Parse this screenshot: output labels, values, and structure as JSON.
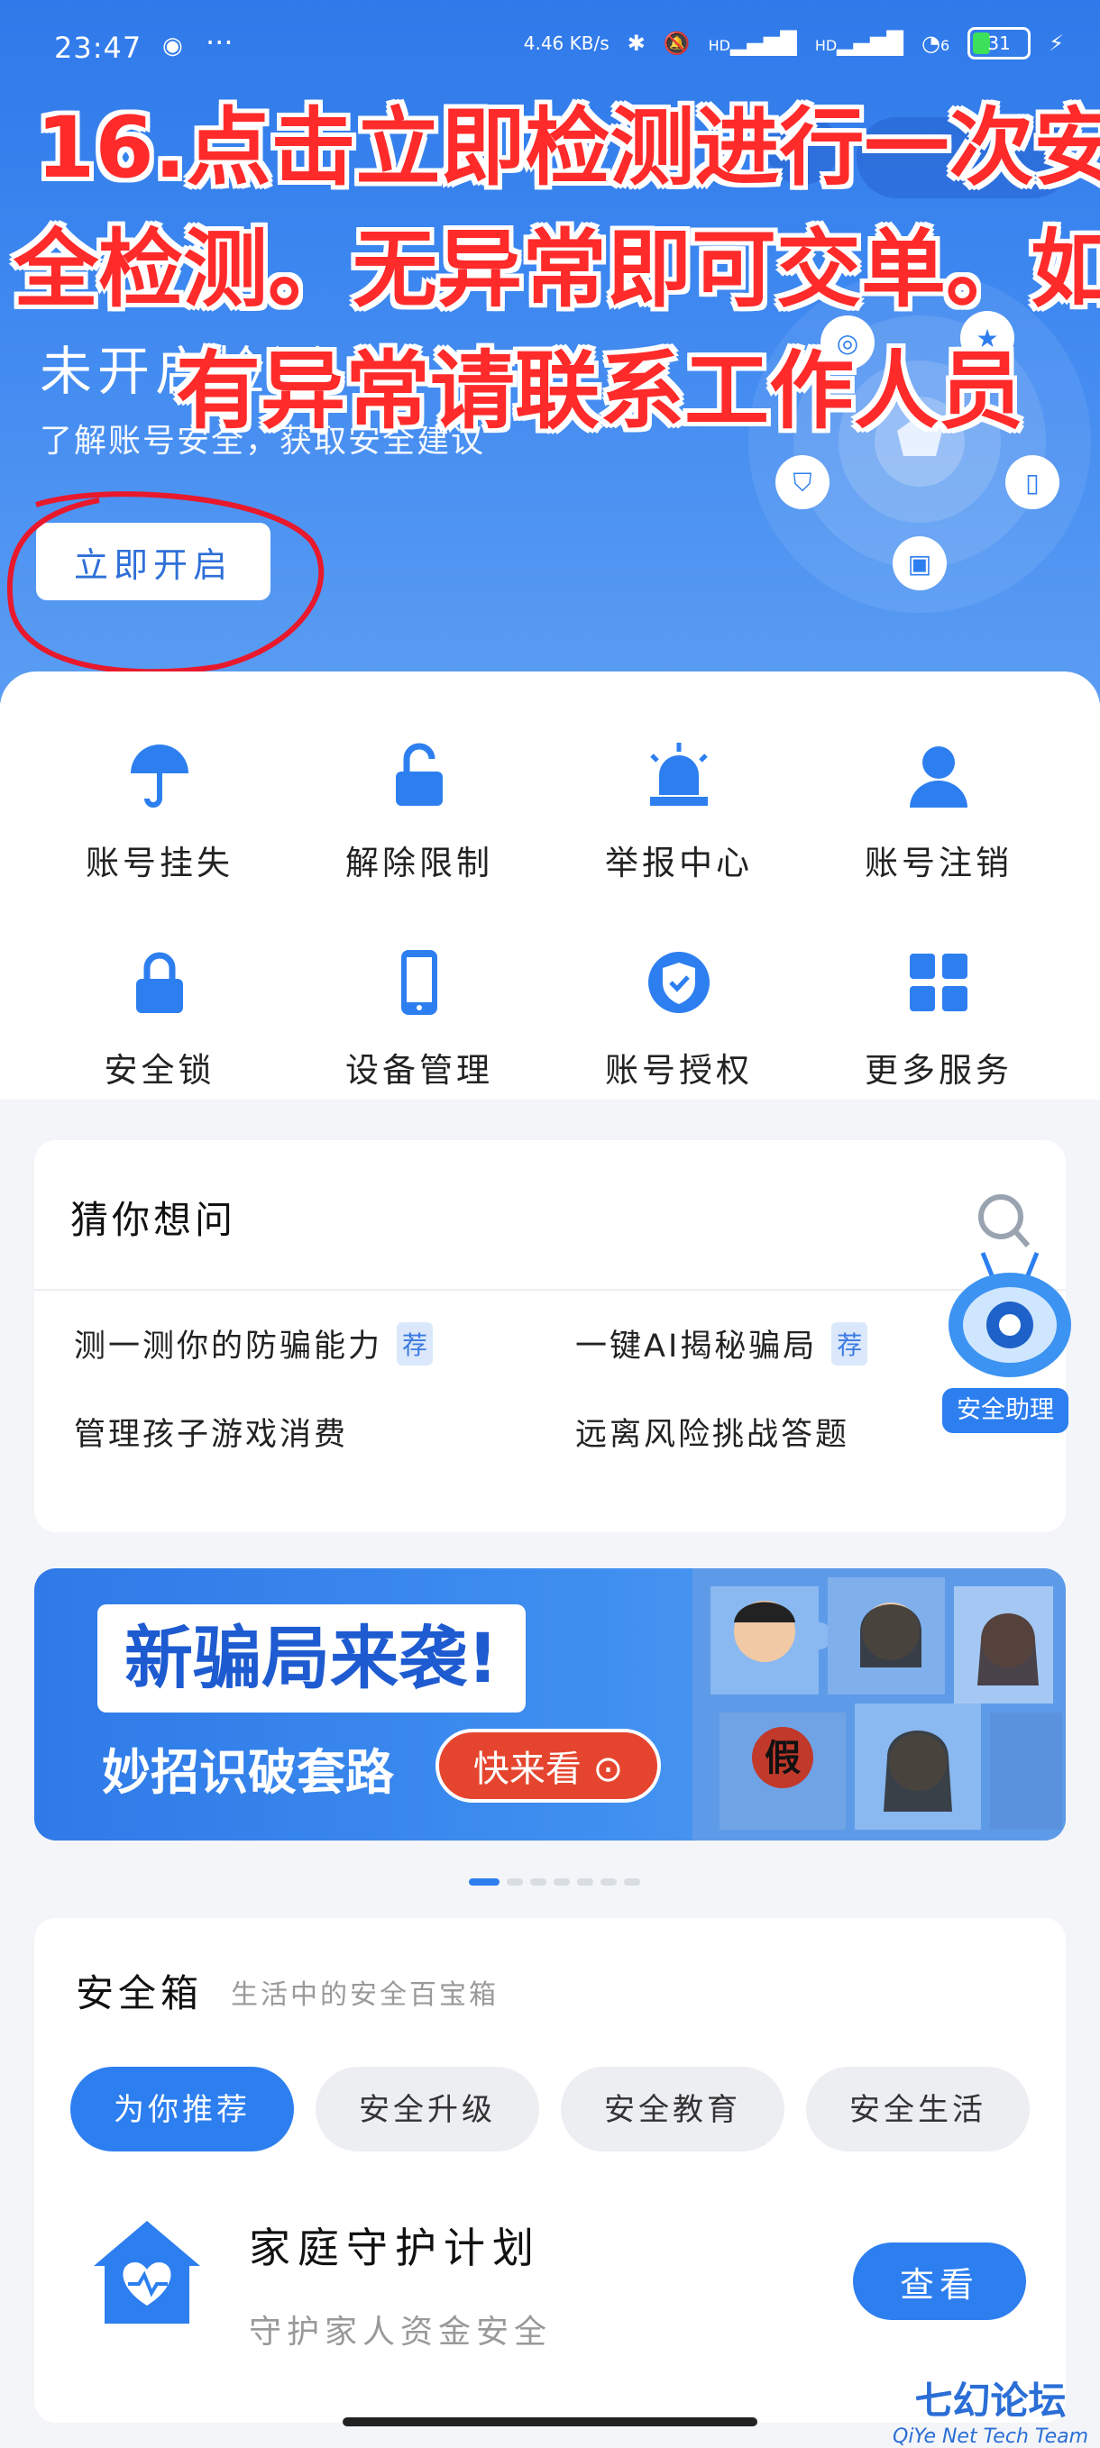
{
  "status_bar": {
    "time": "23:47",
    "network_speed": "4.46 KB/s",
    "hd1": "HD",
    "hd2": "HD",
    "wifi": "6",
    "battery": "31"
  },
  "overlay_instruction": {
    "line1": "16.点击立即检测进行一次安",
    "line2": "全检测。无异常即可交单。如",
    "line3": "有异常请联系工作人员"
  },
  "hero": {
    "title": "未开启检测",
    "subtitle": "了解账号安全，获取安全建议",
    "start_button": "立即开启"
  },
  "services": [
    {
      "label": "账号挂失",
      "icon": "umbrella-icon"
    },
    {
      "label": "解除限制",
      "icon": "unlock-icon"
    },
    {
      "label": "举报中心",
      "icon": "alarm-icon"
    },
    {
      "label": "账号注销",
      "icon": "person-icon"
    },
    {
      "label": "安全锁",
      "icon": "lock-icon"
    },
    {
      "label": "设备管理",
      "icon": "phone-icon"
    },
    {
      "label": "账号授权",
      "icon": "shield-check-icon"
    },
    {
      "label": "更多服务",
      "icon": "grid-icon"
    }
  ],
  "guess": {
    "title": "猜你想问",
    "recommend_tag": "荐",
    "questions": [
      "测一测你的防骗能力",
      "一键AI揭秘骗局",
      "管理孩子游戏消费",
      "远离风险挑战答题"
    ]
  },
  "assistant": {
    "label": "安全助理"
  },
  "banner": {
    "headline": "新骗局来袭!",
    "subline": "妙招识破套路",
    "button": "快来看 ⊙",
    "fake_sign": "假"
  },
  "carousel": {
    "count": 7,
    "active_index": 0
  },
  "safety_box": {
    "title": "安全箱",
    "subtitle": "生活中的安全百宝箱",
    "tabs": [
      "为你推荐",
      "安全升级",
      "安全教育",
      "安全生活"
    ],
    "active_tab": 0,
    "item": {
      "title": "家庭守护计划",
      "subtitle": "守护家人资金安全",
      "button": "查看"
    }
  },
  "watermark": {
    "line1": "七幻论坛",
    "line2": "QiYe Net Tech Team"
  },
  "colors": {
    "accent": "#2d7ff0",
    "overlay_red": "#ff2a2a",
    "banner_button": "#e5452f"
  }
}
